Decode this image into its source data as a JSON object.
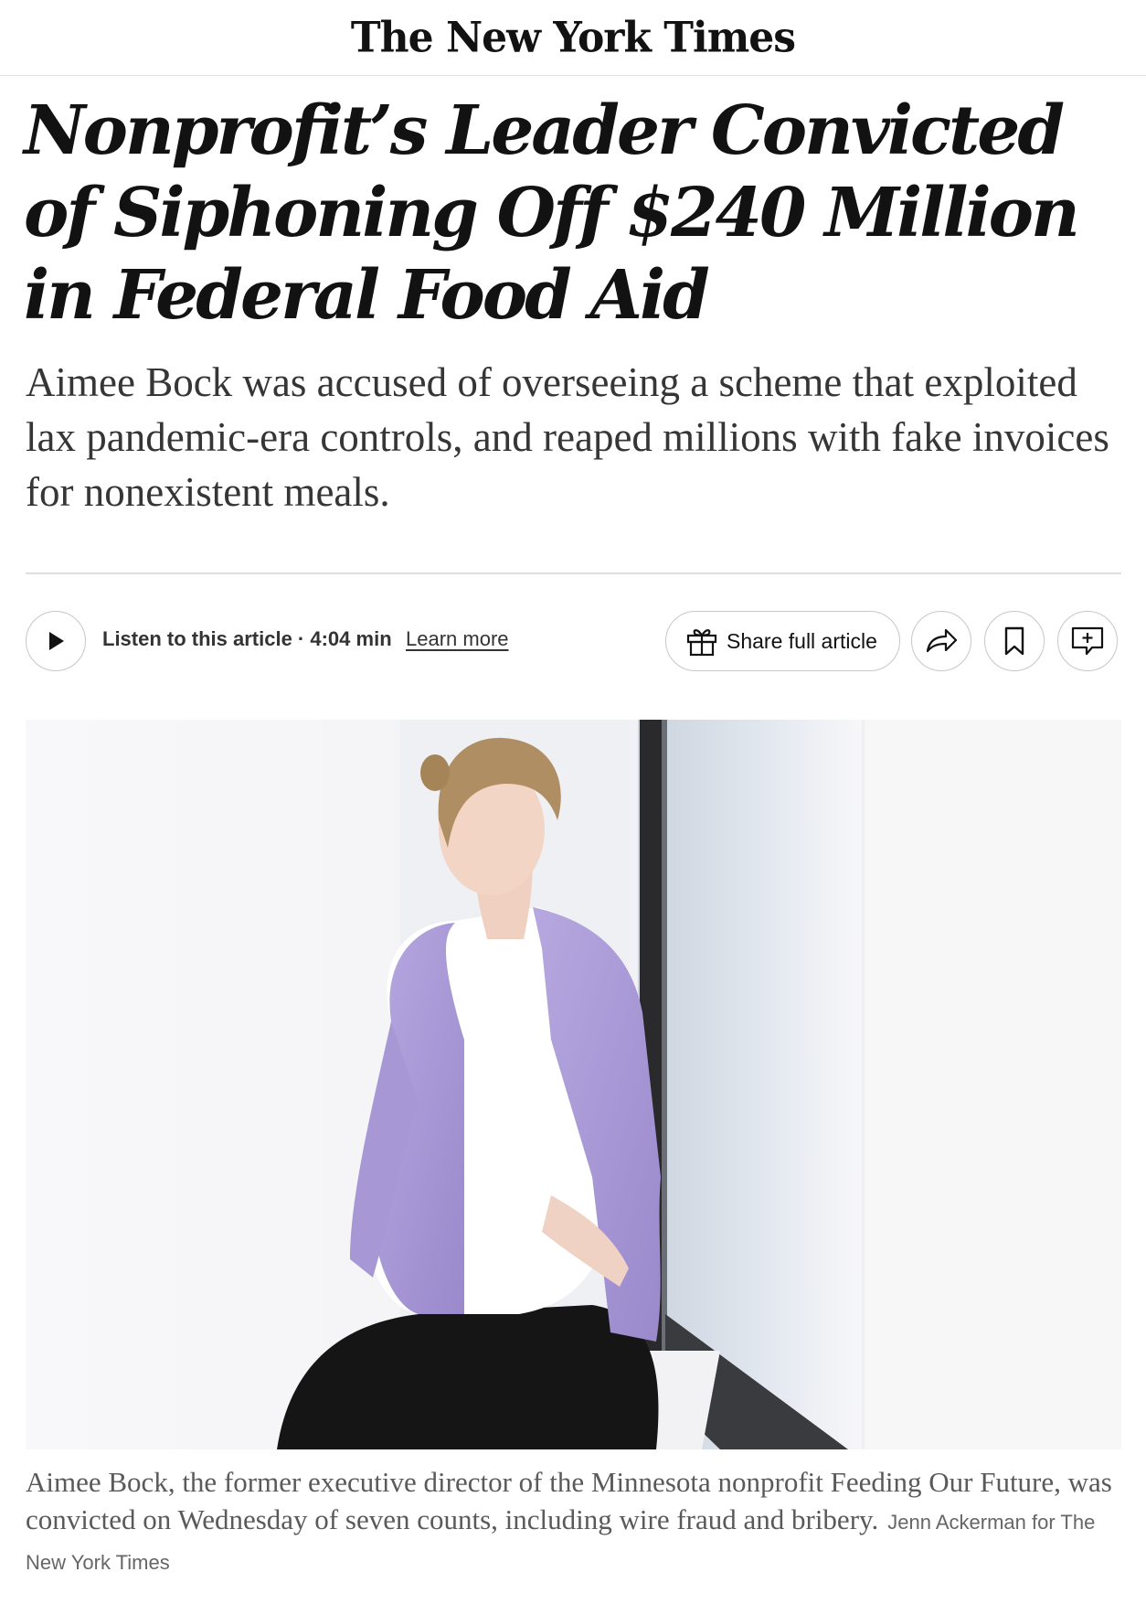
{
  "masthead": {
    "title": "The New York Times"
  },
  "article": {
    "headline": "Nonprofit’s Leader Convicted of Siphoning Off $240 Million in Federal Food Aid",
    "summary": "Aimee Bock was accused of overseeing a scheme that exploited lax pandemic-era controls, and reaped millions with fake invoices for nonexistent meals."
  },
  "toolbar": {
    "listen_label": "Listen to this article · 4:04 min",
    "learn_more": "Learn more",
    "share_full_label": "Share full article",
    "icons": [
      "play-icon",
      "gift-icon",
      "share-arrow-icon",
      "bookmark-icon",
      "comment-icon"
    ]
  },
  "photo": {
    "caption": "Aimee Bock, the former executive director of the Minnesota nonprofit Feeding Our Future, was convicted on Wednesday of seven counts, including wire fraud and bribery.",
    "credit": "Jenn Ackerman for The New York Times"
  }
}
